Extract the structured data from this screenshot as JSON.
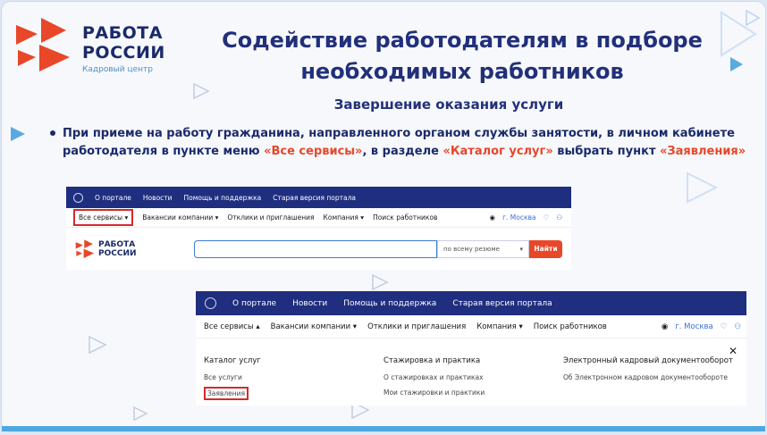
{
  "logo": {
    "line1": "РАБОТА",
    "line2": "РОССИИ",
    "sub": "Кадровый центр"
  },
  "title": "Содействие  работодателям в подборе необходимых работников",
  "subtitle": "Завершение оказания услуги",
  "bullet": {
    "part1": "При приеме на работу гражданина, направленного органом службы занятости, в личном кабинете работодателя  в пункте меню ",
    "hl1": "«Все сервисы»",
    "part2": ", в разделе ",
    "hl2": "«Каталог услуг»",
    "part3": " выбрать пункт ",
    "hl3": "«Заявления»"
  },
  "shot1": {
    "topnav": [
      "О портале",
      "Новости",
      "Помощь и поддержка",
      "Старая версия портала"
    ],
    "menu": [
      "Все сервисы",
      "Вакансии компании",
      "Отклики и приглашения",
      "Компания",
      "Поиск работников"
    ],
    "city": "г. Москва",
    "logo1": "РАБОТА",
    "logo2": "РОССИИ",
    "scope": "по всему резюме",
    "find": "Найти"
  },
  "shot2": {
    "topnav": [
      "О портале",
      "Новости",
      "Помощь и поддержка",
      "Старая версия портала"
    ],
    "menu": [
      "Все сервисы",
      "Вакансии компании",
      "Отклики и приглашения",
      "Компания",
      "Поиск работников"
    ],
    "city": "г. Москва",
    "col1": {
      "head": "Каталог услуг",
      "item1": "Все услуги",
      "item2": "Заявления"
    },
    "col2": {
      "head": "Стажировка и практика",
      "item1": "О стажировках и практиках",
      "item2": "Мои стажировки и практики"
    },
    "col3": {
      "head": "Электронный кадровый документооборот",
      "item1": "Об Электронном кадровом документообороте"
    }
  },
  "colors": {
    "brand_blue": "#1f2e7e",
    "accent_red": "#e8472a",
    "title_blue": "#22307a"
  }
}
